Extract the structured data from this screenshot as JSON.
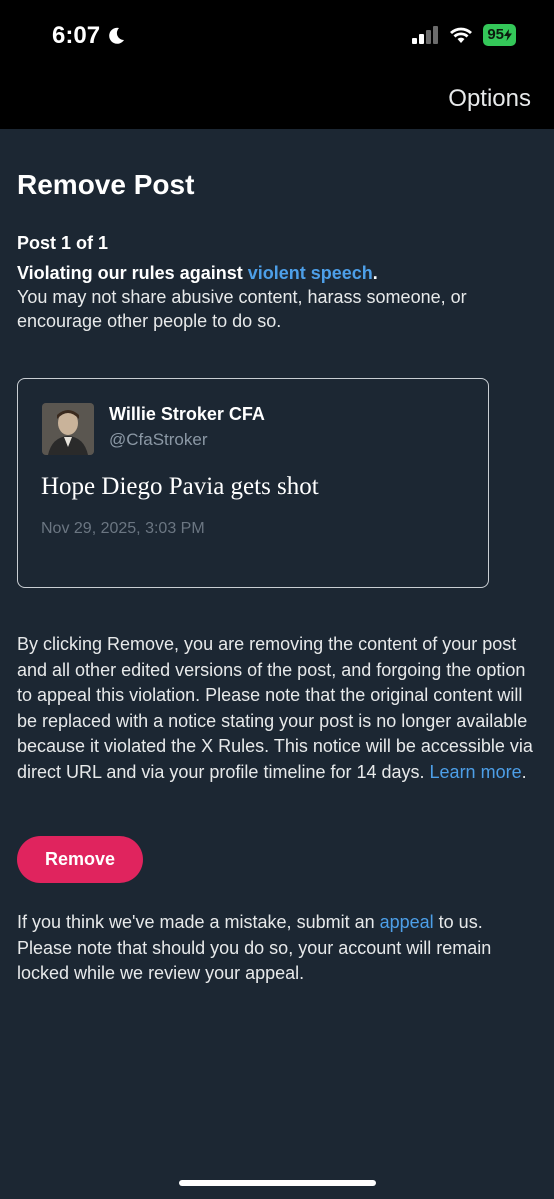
{
  "status_bar": {
    "time": "6:07",
    "battery": "95"
  },
  "header": {
    "options_label": "Options"
  },
  "page": {
    "title": "Remove Post",
    "post_count": "Post 1 of 1",
    "violation_prefix": "Violating our rules against ",
    "violation_link": "violent speech",
    "violation_suffix": ".",
    "violation_description": "You may not share abusive content, harass someone, or encourage other people to do so."
  },
  "tweet": {
    "author_name": "Willie Stroker CFA",
    "author_handle": "@CfaStroker",
    "text": "Hope Diego Pavia gets shot",
    "date": "Nov 29, 2025, 3:03 PM"
  },
  "removal_notice": {
    "text": "By clicking Remove, you are removing the content of your post and all other edited versions of the post, and forgoing the option to appeal this violation. Please note that the original content will be replaced with a notice stating your post is no longer available because it violated the X Rules. This notice will be accessible via direct URL and via your profile timeline for 14 days. ",
    "link": "Learn more",
    "suffix": "."
  },
  "remove_button_label": "Remove",
  "appeal_notice": {
    "prefix": "If you think we've made a mistake, submit an ",
    "link": "appeal",
    "suffix": " to us. Please note that should you do so, your account will remain locked while we review your appeal."
  },
  "colors": {
    "background": "#1c2733",
    "link": "#4d9fe8",
    "remove_button": "#e0245e",
    "battery": "#34c759"
  },
  "icons": [
    "moon-icon",
    "signal-icon",
    "wifi-icon",
    "battery-icon"
  ]
}
